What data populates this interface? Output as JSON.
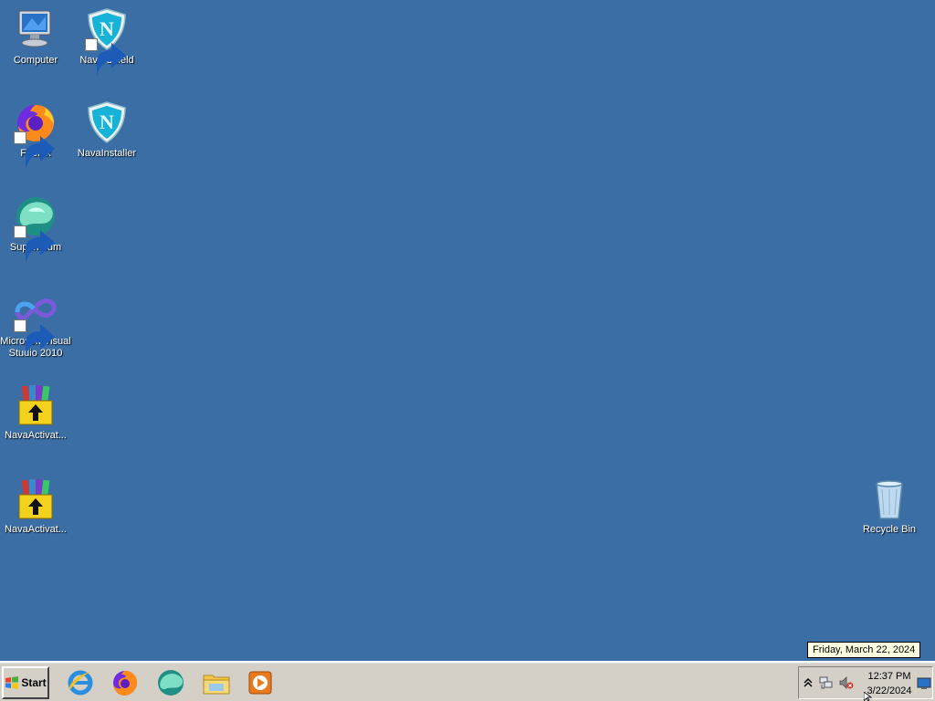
{
  "desktop_icons": {
    "computer": "Computer",
    "nava_shield": "Nava Shield",
    "firefox": "Firefox",
    "nava_installer": "NavaInstaller",
    "supermium": "Supermium",
    "visual_studio": "Microsoft Visual Studio 2010",
    "nava_activator_1": "NavaActivat...",
    "nava_activator_2": "NavaActivat...",
    "recycle_bin": "Recycle Bin"
  },
  "taskbar": {
    "start_label": "Start",
    "quick_launch": [
      "internet-explorer-icon",
      "firefox-icon",
      "supermium-icon",
      "file-explorer-icon",
      "media-player-icon"
    ]
  },
  "tray": {
    "time": "12:37 PM",
    "date": "3/22/2024",
    "tooltip": "Friday, March 22, 2024",
    "icons": [
      "show-hidden-icons-chevron",
      "network-icon",
      "volume-muted-icon",
      "show-desktop-icon"
    ]
  },
  "colors": {
    "desktop_background": "#3b6ea5",
    "taskbar": "#d4d0c8",
    "tooltip_background": "#ffffe1"
  }
}
